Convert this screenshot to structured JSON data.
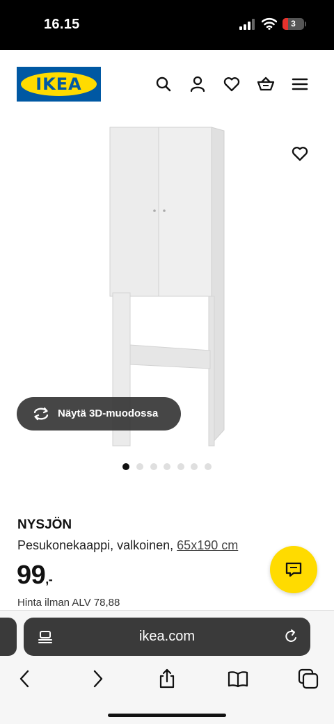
{
  "status_bar": {
    "time": "16.15",
    "battery_level": "3",
    "icons": [
      "cellular-signal-icon",
      "wifi-icon",
      "battery-icon"
    ]
  },
  "header": {
    "logo_text": "IKEA",
    "icons": [
      "search-icon",
      "user-icon",
      "heart-icon",
      "basket-icon",
      "menu-icon"
    ],
    "brand_colors": {
      "blue": "#0058a3",
      "yellow": "#ffdb00"
    }
  },
  "gallery": {
    "view_3d_label": "Näytä 3D-muodossa",
    "dot_count": 7,
    "active_index": 0
  },
  "product": {
    "name": "NYSJÖN",
    "description": "Pesukonekaappi, valkoinen,",
    "size": "65x190 cm",
    "price_main": "99",
    "price_suffix": ",-",
    "vat_label": "Hinta ilman ALV 78,88"
  },
  "browser": {
    "url": "ikea.com",
    "toolbar_icons": [
      "back-icon",
      "forward-icon",
      "share-icon",
      "bookmarks-icon",
      "tabs-icon"
    ]
  }
}
